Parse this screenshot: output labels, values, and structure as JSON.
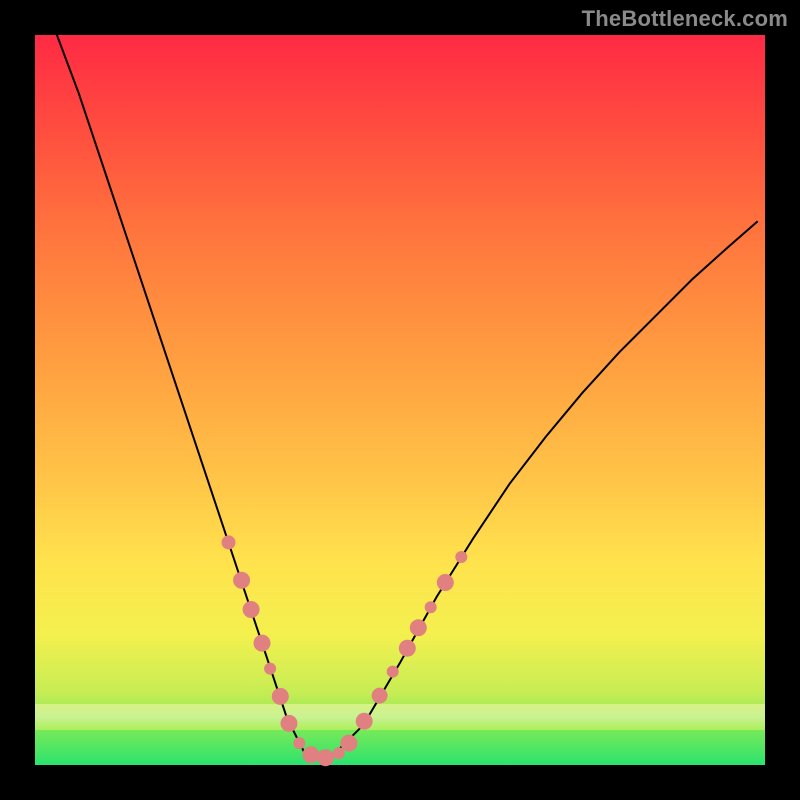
{
  "watermark": "TheBottleneck.com",
  "colors": {
    "frame": "#000000",
    "curve": "#000000",
    "marker_fill": "#e08080",
    "marker_stroke": "#c86868",
    "gradient_stops": [
      {
        "t": 0.0,
        "hex": "#2be36e"
      },
      {
        "t": 0.04,
        "hex": "#6be85c"
      },
      {
        "t": 0.1,
        "hex": "#c7ed54"
      },
      {
        "t": 0.18,
        "hex": "#f4f04e"
      },
      {
        "t": 0.28,
        "hex": "#ffe24d"
      },
      {
        "t": 0.38,
        "hex": "#ffc748"
      },
      {
        "t": 0.5,
        "hex": "#ffab42"
      },
      {
        "t": 0.62,
        "hex": "#ff8f3f"
      },
      {
        "t": 0.74,
        "hex": "#ff723e"
      },
      {
        "t": 0.86,
        "hex": "#ff503f"
      },
      {
        "t": 1.0,
        "hex": "#ff2a44"
      }
    ]
  },
  "chart_data": {
    "type": "line",
    "title": "",
    "xlabel": "",
    "ylabel": "",
    "xlim": [
      0,
      1
    ],
    "ylim": [
      0,
      1
    ],
    "legend": false,
    "grid": false,
    "series": [
      {
        "name": "bottleneck-curve",
        "x": [
          0.03,
          0.06,
          0.1,
          0.14,
          0.18,
          0.22,
          0.26,
          0.295,
          0.32,
          0.345,
          0.37,
          0.41,
          0.45,
          0.5,
          0.55,
          0.6,
          0.65,
          0.7,
          0.75,
          0.8,
          0.85,
          0.9,
          0.95,
          0.99
        ],
        "y": [
          1.0,
          0.92,
          0.8,
          0.68,
          0.56,
          0.44,
          0.32,
          0.215,
          0.14,
          0.065,
          0.015,
          0.015,
          0.055,
          0.14,
          0.23,
          0.31,
          0.385,
          0.45,
          0.51,
          0.565,
          0.615,
          0.665,
          0.71,
          0.745
        ]
      }
    ],
    "markers": {
      "name": "highlighted-points",
      "fill": "#e08080",
      "points": [
        {
          "x": 0.265,
          "y": 0.305,
          "r": 7
        },
        {
          "x": 0.283,
          "y": 0.253,
          "r": 8.5
        },
        {
          "x": 0.296,
          "y": 0.213,
          "r": 8.5
        },
        {
          "x": 0.311,
          "y": 0.167,
          "r": 8.5
        },
        {
          "x": 0.322,
          "y": 0.132,
          "r": 6
        },
        {
          "x": 0.336,
          "y": 0.094,
          "r": 8.5
        },
        {
          "x": 0.348,
          "y": 0.057,
          "r": 8.5
        },
        {
          "x": 0.362,
          "y": 0.03,
          "r": 6
        },
        {
          "x": 0.378,
          "y": 0.014,
          "r": 8.5
        },
        {
          "x": 0.398,
          "y": 0.01,
          "r": 8.5
        },
        {
          "x": 0.416,
          "y": 0.016,
          "r": 6
        },
        {
          "x": 0.43,
          "y": 0.03,
          "r": 8.5
        },
        {
          "x": 0.451,
          "y": 0.06,
          "r": 8.5
        },
        {
          "x": 0.472,
          "y": 0.095,
          "r": 8
        },
        {
          "x": 0.49,
          "y": 0.128,
          "r": 6
        },
        {
          "x": 0.51,
          "y": 0.16,
          "r": 8.5
        },
        {
          "x": 0.525,
          "y": 0.188,
          "r": 8.5
        },
        {
          "x": 0.542,
          "y": 0.216,
          "r": 6
        },
        {
          "x": 0.562,
          "y": 0.25,
          "r": 8.5
        },
        {
          "x": 0.584,
          "y": 0.285,
          "r": 6
        }
      ]
    }
  }
}
